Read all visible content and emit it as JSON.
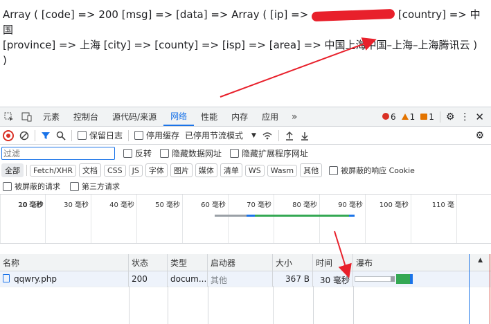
{
  "page": {
    "line1_a": "Array ( [code] => 200 [msg] => [data] => Array ( [ip] => ",
    "line1_b": " [country] => 中国",
    "line2": "[province] => 上海 [city] => [county] => [isp] => [area] => 中国上海中国–上海–上海腾讯云 )",
    "line3": ")"
  },
  "devtools": {
    "tabs": [
      "元素",
      "控制台",
      "源代码/来源",
      "网络",
      "性能",
      "内存",
      "应用"
    ],
    "active_tab": "网络",
    "errors": "6",
    "warnings": "1",
    "info": "1"
  },
  "toolbar": {
    "preserve_log": "保留日志",
    "disable_cache": "停用缓存",
    "throttle": "已停用节流模式"
  },
  "filter": {
    "placeholder": "过滤",
    "invert": "反转",
    "hide_data_urls": "隐藏数据网址",
    "hide_ext_urls": "隐藏扩展程序网址"
  },
  "types": [
    "全部",
    "Fetch/XHR",
    "文档",
    "CSS",
    "JS",
    "字体",
    "图片",
    "媒体",
    "清单",
    "WS",
    "Wasm",
    "其他"
  ],
  "blocked_cookies": "被屏蔽的响应 Cookie",
  "blocked_requests": "被屏蔽的请求",
  "third_party": "第三方请求",
  "timeline_ticks": [
    "10 毫秒",
    "20 毫秒",
    "30 毫秒",
    "40 毫秒",
    "50 毫秒",
    "60 毫秒",
    "70 毫秒",
    "80 毫秒",
    "90 毫秒",
    "100 毫秒",
    "110 毫"
  ],
  "columns": [
    "名称",
    "状态",
    "类型",
    "启动器",
    "大小",
    "时间",
    "瀑布"
  ],
  "rows": [
    {
      "name": "qqwry.php",
      "status": "200",
      "type": "docum...",
      "initiator": "其他",
      "size": "367 B",
      "time": "30 毫秒"
    }
  ],
  "colors": {
    "accent": "#1a73e8",
    "annotation": "#e8202b"
  }
}
